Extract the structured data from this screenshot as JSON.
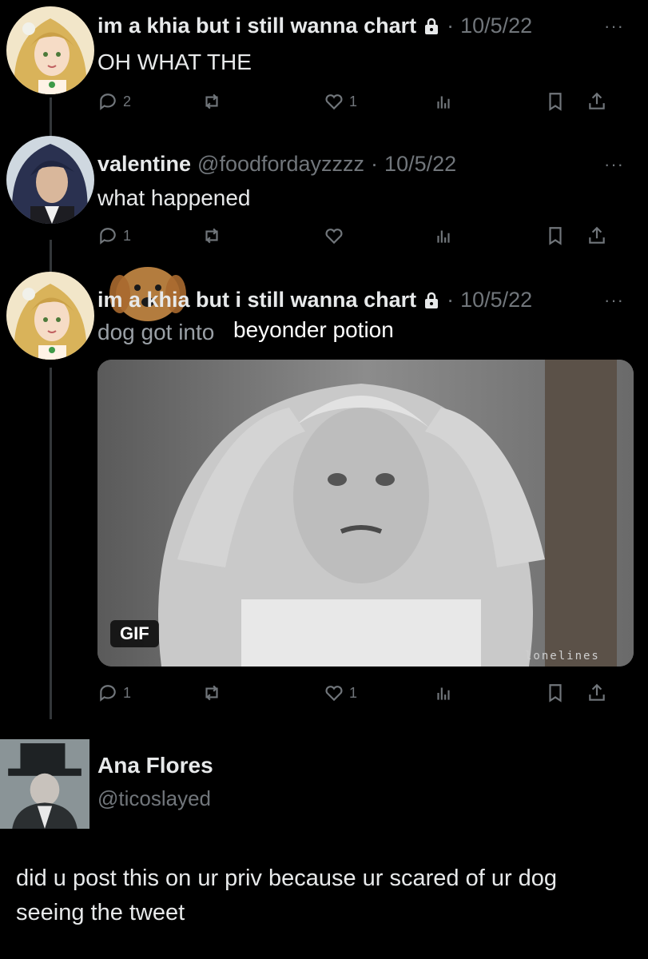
{
  "tweets": [
    {
      "name": "im a khia but i still wanna chart",
      "handle": "",
      "date": "10/5/22",
      "text": "OH WHAT THE",
      "replies": "2",
      "likes": "1"
    },
    {
      "name": "valentine",
      "handle": "@foodfordayzzzz",
      "date": "10/5/22",
      "text": "what happened",
      "replies": "1",
      "likes": ""
    },
    {
      "name": "im a khia but i still wanna chart",
      "handle": "",
      "date": "10/5/22",
      "text": "dog got into",
      "overlay_text": "beyonder potion",
      "media_badge": "GIF",
      "media_watermark": "lonelines",
      "replies": "1",
      "likes": "1"
    }
  ],
  "reply": {
    "name": "Ana Flores",
    "handle": "@ticoslayed",
    "text": "did  u post this on ur priv because ur scared of ur dog seeing the tweet"
  },
  "more_glyph": "···",
  "separator": "·"
}
